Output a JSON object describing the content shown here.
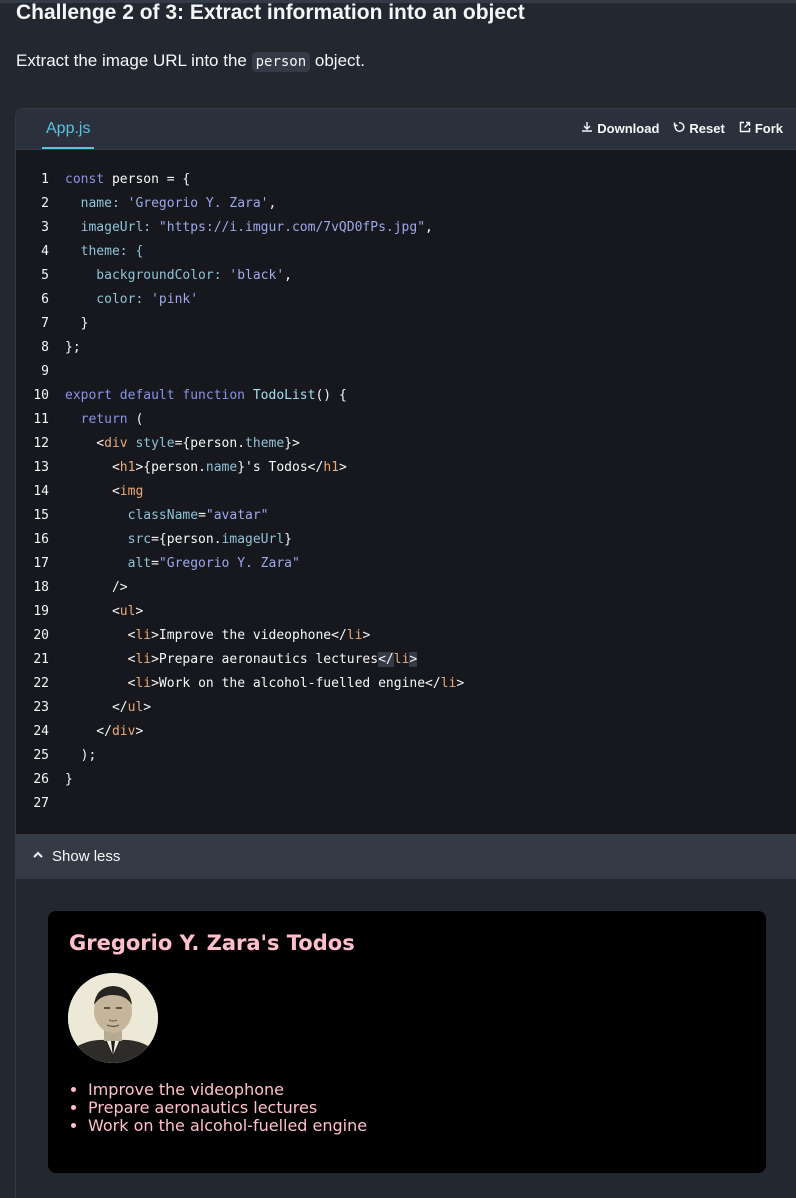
{
  "challenge": {
    "title": "Challenge 2 of 3: Extract information into an object",
    "desc_before": "Extract the image URL into the ",
    "desc_code": "person",
    "desc_after": " object."
  },
  "sandbox": {
    "tab": "App.js",
    "actions": {
      "download": "Download",
      "reset": "Reset",
      "fork": "Fork"
    },
    "show_less": "Show less",
    "line_numbers": [
      "1",
      "2",
      "3",
      "4",
      "5",
      "6",
      "7",
      "8",
      "9",
      "10",
      "11",
      "12",
      "13",
      "14",
      "15",
      "16",
      "17",
      "18",
      "19",
      "20",
      "21",
      "22",
      "23",
      "24",
      "25",
      "26",
      "27"
    ]
  },
  "code": {
    "l1": [
      "const",
      " person = {"
    ],
    "l2": [
      "  name: ",
      "'Gregorio Y. Zara'",
      ","
    ],
    "l3": [
      "  imageUrl: ",
      "\"https://i.imgur.com/7vQD0fPs.jpg\"",
      ","
    ],
    "l4": [
      "  theme: {"
    ],
    "l5": [
      "    backgroundColor: ",
      "'black'",
      ","
    ],
    "l6": [
      "    color: ",
      "'pink'"
    ],
    "l7": [
      "  }"
    ],
    "l8": [
      "};"
    ],
    "l10": [
      "export default function ",
      "TodoList",
      "() {"
    ],
    "l11": [
      "  return",
      " ("
    ],
    "l12": [
      "    <",
      "div",
      " style",
      "={person.",
      "theme",
      "}>"
    ],
    "l13": [
      "      <",
      "h1",
      ">{person.",
      "name",
      "}'s Todos</",
      "h1",
      ">"
    ],
    "l14": [
      "      <",
      "img"
    ],
    "l15": [
      "        className",
      "=",
      "\"avatar\""
    ],
    "l16": [
      "        src",
      "={person.",
      "imageUrl",
      "}"
    ],
    "l17": [
      "        alt",
      "=",
      "\"Gregorio Y. Zara\""
    ],
    "l18": [
      "      />"
    ],
    "l19": [
      "      <",
      "ul",
      ">"
    ],
    "l20": [
      "        <",
      "li",
      ">Improve the videophone</",
      "li",
      ">"
    ],
    "l21": [
      "        <",
      "li",
      ">Prepare aeronautics lectures",
      "</",
      "li",
      ">"
    ],
    "l22": [
      "        <",
      "li",
      ">Work on the alcohol-fuelled engine</",
      "li",
      ">"
    ],
    "l23": [
      "      </",
      "ul",
      ">"
    ],
    "l24": [
      "    </",
      "div",
      ">"
    ],
    "l25": [
      "  );"
    ],
    "l26": [
      "}"
    ]
  },
  "preview": {
    "title": "Gregorio Y. Zara's Todos",
    "todos": [
      "Improve the videophone",
      "Prepare aeronautics lectures",
      "Work on the alcohol-fuelled engine"
    ]
  },
  "colors": {
    "accent": "#58c4dc",
    "preview_text": "#ffc0cb",
    "preview_bg": "#000000"
  }
}
